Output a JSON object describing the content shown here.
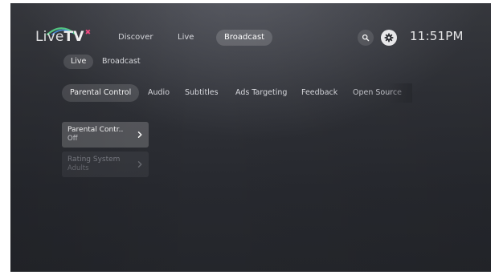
{
  "logo": {
    "part1": "Live",
    "part2": "TV",
    "mark": "✖"
  },
  "topnav": {
    "items": [
      "Discover",
      "Live",
      "Broadcast"
    ],
    "active": "Broadcast"
  },
  "header": {
    "search_icon": "search-icon",
    "settings_icon": "gear-icon",
    "time": "11:51PM"
  },
  "subtabs": {
    "items": [
      "Live",
      "Broadcast"
    ],
    "active": "Live"
  },
  "categories": {
    "items": [
      "Parental Control",
      "Audio",
      "Subtitles",
      "Ads Targeting",
      "Feedback",
      "Open Source"
    ],
    "active": "Parental Control"
  },
  "settings": [
    {
      "title": "Parental Contr..",
      "value": "Off",
      "state": "focused"
    },
    {
      "title": "Rating System",
      "value": "Adults",
      "state": "disabled"
    }
  ],
  "colors": {
    "accent_pink": "#ff4d88",
    "logo_arc_green": "#59d38a",
    "logo_arc_blue": "#4aa3ff"
  }
}
